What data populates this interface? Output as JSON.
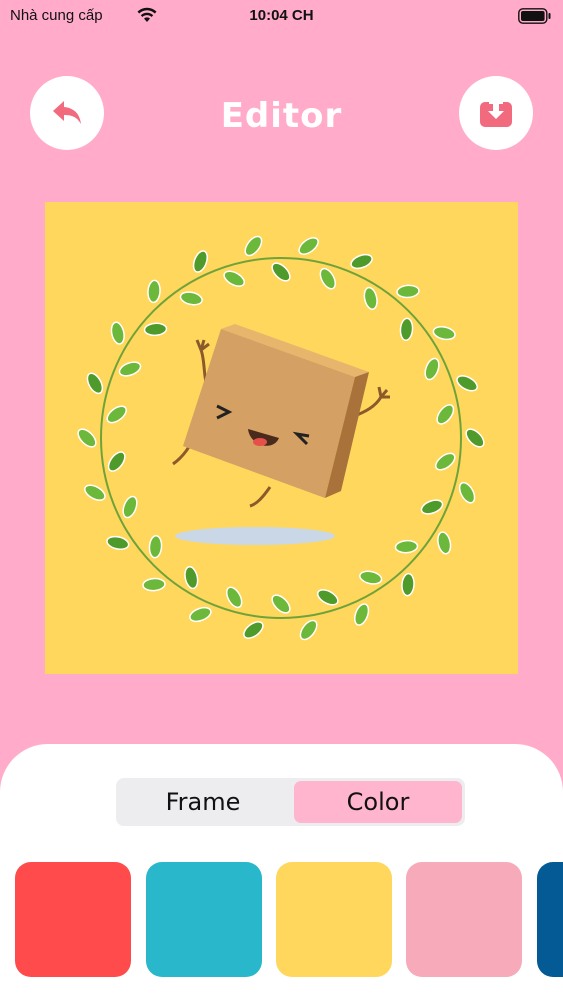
{
  "status_bar": {
    "carrier": "Nhà cung cấp",
    "time": "10:04 CH"
  },
  "header": {
    "title": "Editor",
    "back_icon": "back-arrow-icon",
    "download_icon": "download-icon"
  },
  "tabs": {
    "frame_label": "Frame",
    "color_label": "Color",
    "selected": "Color"
  },
  "colors": {
    "background": "#FFABC9",
    "canvas_background": "#FFD75D",
    "swatches": [
      "#FF4B4B",
      "#29B8CB",
      "#FFD75D",
      "#F7ABBA",
      "#045A94"
    ]
  }
}
